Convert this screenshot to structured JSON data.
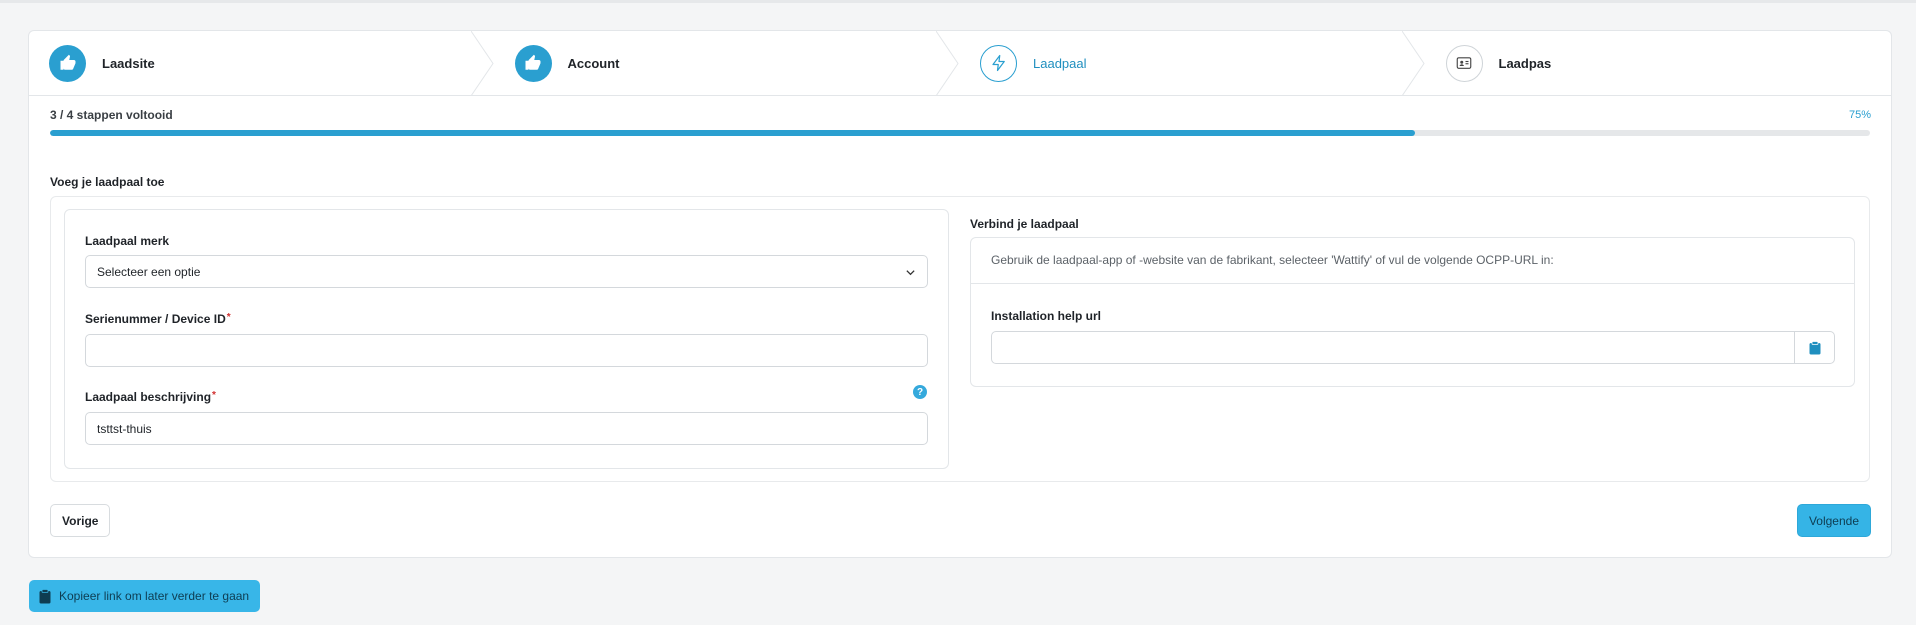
{
  "stepper": {
    "steps": [
      {
        "label": "Laadsite",
        "state": "done",
        "icon": "thumbs-up-icon"
      },
      {
        "label": "Account",
        "state": "done",
        "icon": "thumbs-up-icon"
      },
      {
        "label": "Laadpaal",
        "state": "active",
        "icon": "lightning-icon"
      },
      {
        "label": "Laadpas",
        "state": "pending",
        "icon": "id-card-icon"
      }
    ]
  },
  "progress": {
    "text": "3 / 4 stappen voltooid",
    "percent_label": "75%",
    "value": 0.75
  },
  "form": {
    "section_title": "Voeg je laadpaal toe",
    "brand": {
      "label": "Laadpaal merk",
      "selected": "Selecteer een optie"
    },
    "serial": {
      "label": "Serienummer / Device ID",
      "required_mark": "*",
      "value": ""
    },
    "description": {
      "label": "Laadpaal beschrijving",
      "required_mark": "*",
      "value": "tsttst-thuis",
      "help_icon": "question-icon"
    }
  },
  "connect": {
    "title": "Verbind je laadpaal",
    "description": "Gebruik de laadpaal-app of -website van de fabrikant, selecteer 'Wattify' of vul de volgende OCPP-URL in:",
    "url_label": "Installation help url",
    "url_value": "",
    "copy_icon": "clipboard-icon"
  },
  "nav": {
    "prev_label": "Vorige",
    "next_label": "Volgende"
  },
  "copy_link": {
    "label": "Kopieer link om later verder te gaan",
    "icon": "clipboard-icon"
  },
  "colors": {
    "accent": "#2a9fd0",
    "button": "#35b4e6",
    "required": "#d12f2f"
  }
}
